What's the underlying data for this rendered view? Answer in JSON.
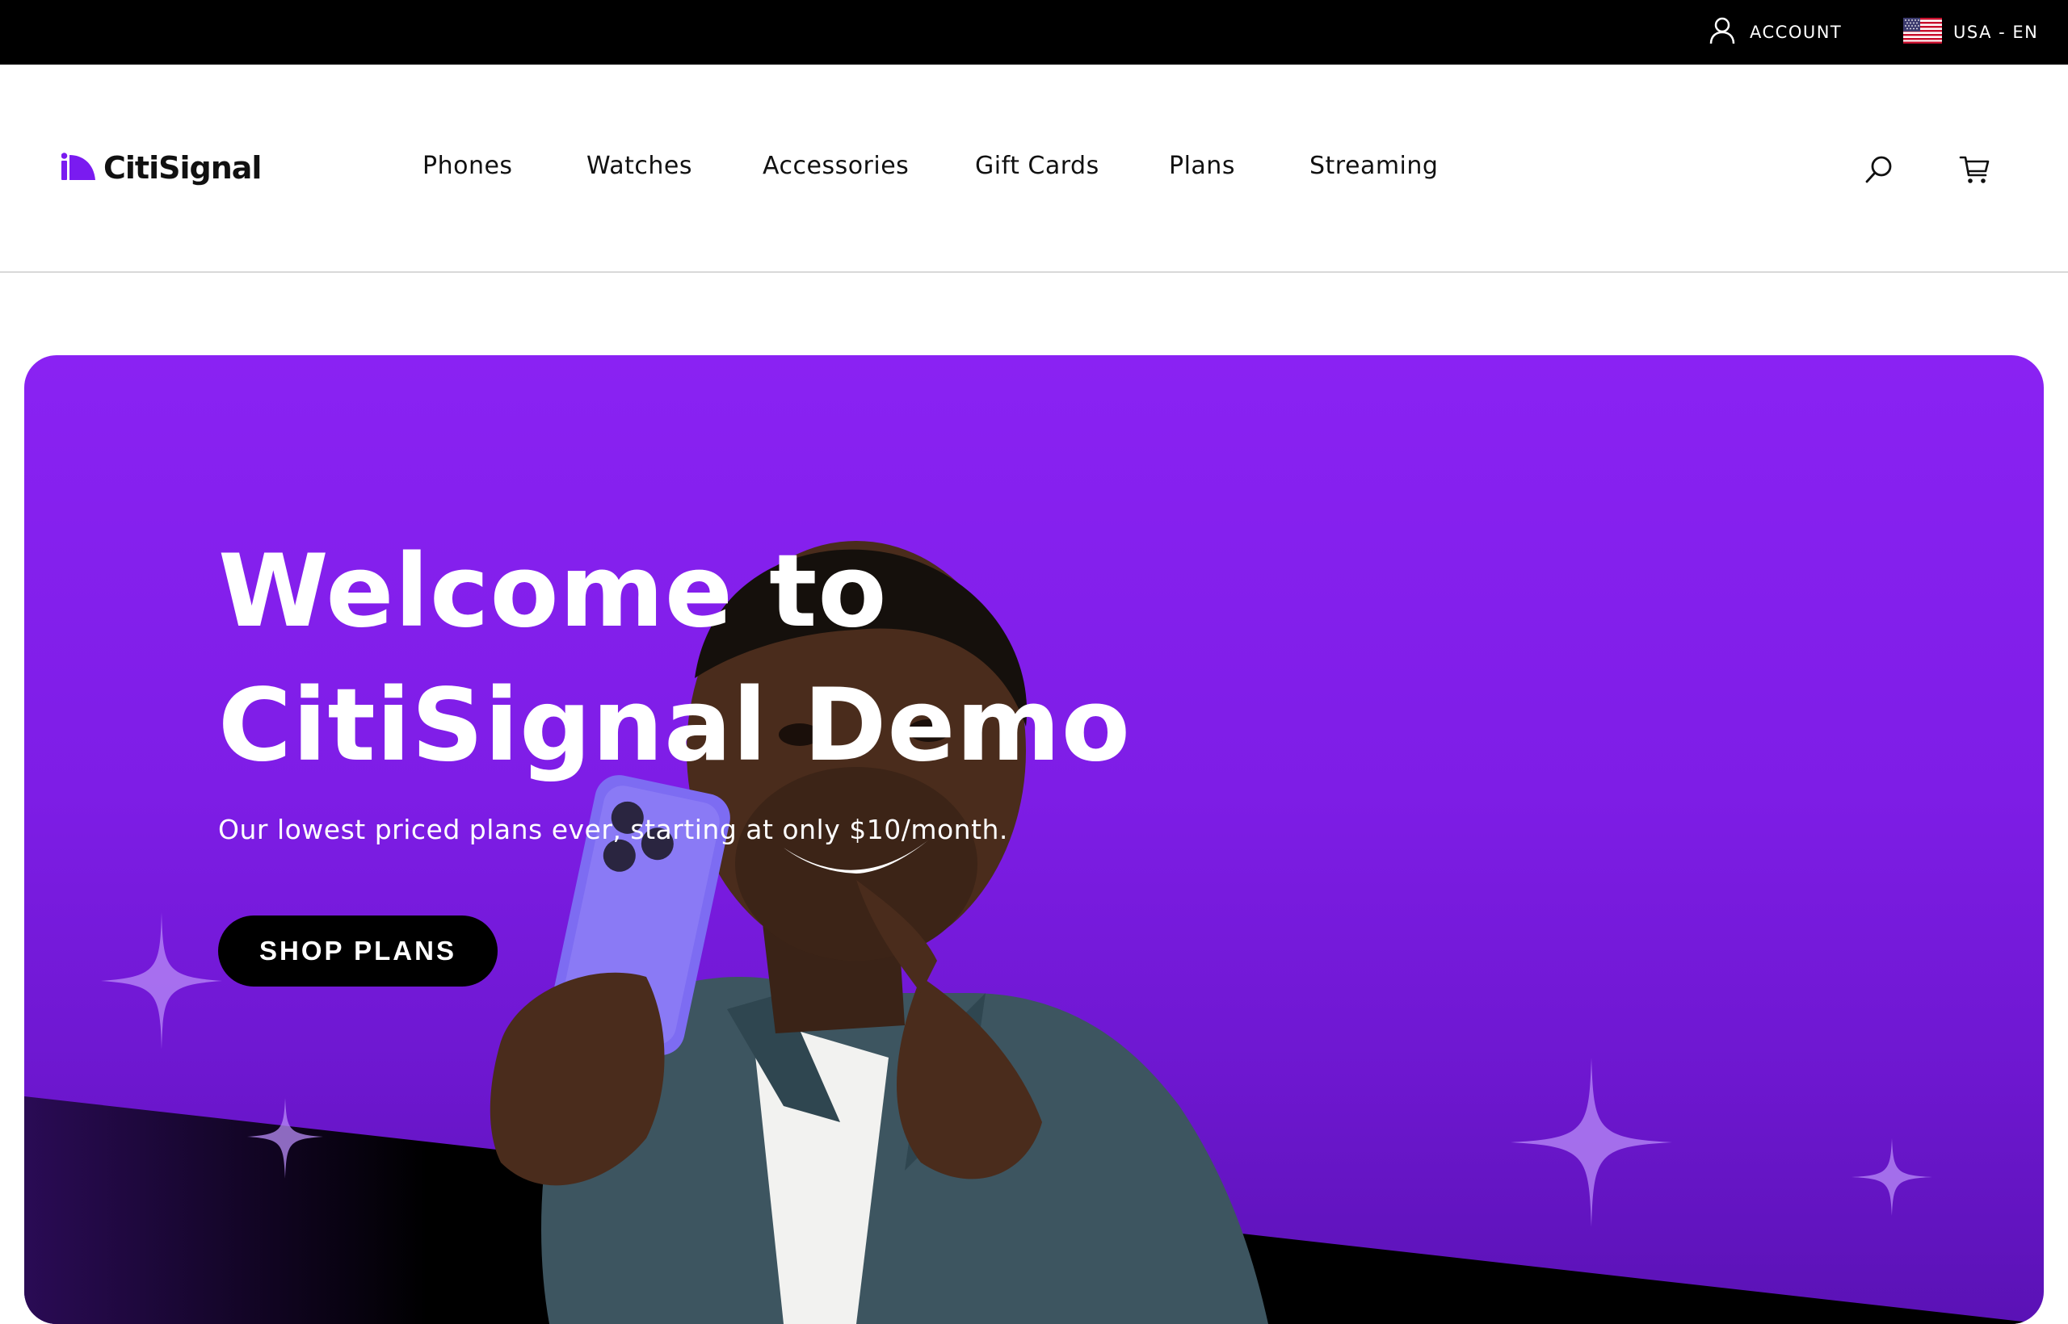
{
  "topbar": {
    "account_label": "ACCOUNT",
    "account_icon": "user-icon",
    "locale_label": "USA - EN",
    "locale_icon": "us-flag-icon"
  },
  "header": {
    "logo_text": "CitiSignal",
    "nav": [
      {
        "label": "Phones"
      },
      {
        "label": "Watches"
      },
      {
        "label": "Accessories"
      },
      {
        "label": "Gift Cards"
      },
      {
        "label": "Plans"
      },
      {
        "label": "Streaming"
      }
    ],
    "search_icon": "search-icon",
    "cart_icon": "cart-icon"
  },
  "hero": {
    "title_line1": "Welcome to",
    "title_line2": "CitiSignal Demo",
    "subtitle": "Our lowest priced plans ever, starting at only $10/month.",
    "cta_label": "SHOP PLANS",
    "accent_color": "#8a22f3"
  }
}
